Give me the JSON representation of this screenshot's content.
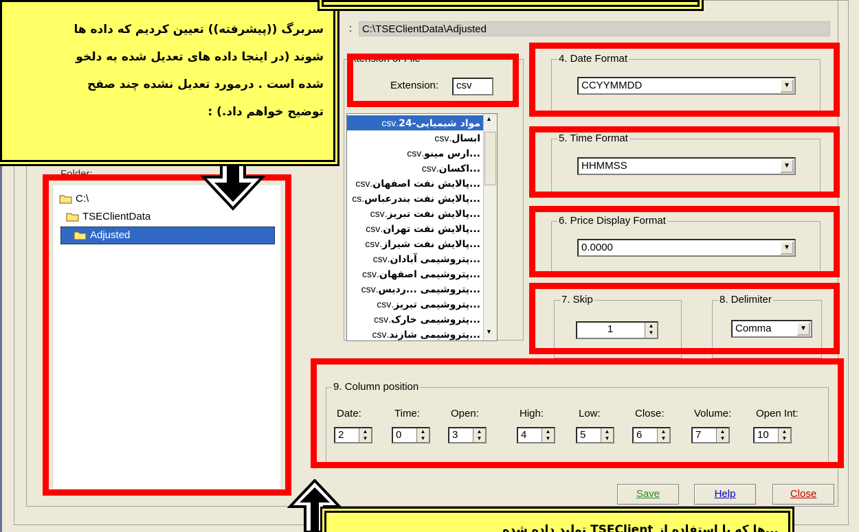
{
  "path": {
    "label": ":",
    "value": "C:\\TSEClientData\\Adjusted"
  },
  "extension_group": {
    "legend": "xtension of File",
    "label": "Extension:",
    "value": "csv"
  },
  "folder": {
    "label": "Folder:",
    "tree": [
      "C:\\",
      "TSEClientData",
      "Adjusted"
    ]
  },
  "files": [
    {
      "name": "مواد شیمیایی-24",
      "ext": ".csv"
    },
    {
      "name": "ابسال",
      "ext": ".csv"
    },
    {
      "name": "...ارس مینو",
      "ext": ".csv"
    },
    {
      "name": "...اکسان",
      "ext": ".csv"
    },
    {
      "name": "...پالایش نفت اصفهان",
      "ext": ".csv"
    },
    {
      "name": "...پالایش نفت بندرعباس",
      "ext": ".cs"
    },
    {
      "name": "...پالایش نفت تبریز",
      "ext": ".csv"
    },
    {
      "name": "...پالایش نفت تهران",
      "ext": ".csv"
    },
    {
      "name": "...پالایش نفت شیراز",
      "ext": ".csv"
    },
    {
      "name": "...پتروشیمی آبادان",
      "ext": ".csv"
    },
    {
      "name": "...پتروشیمی اصفهان",
      "ext": ".csv"
    },
    {
      "name": "...پتروشیمی ...ردیس",
      "ext": ".csv"
    },
    {
      "name": "...پتروشیمی تبریز",
      "ext": ".csv"
    },
    {
      "name": "...پتروشیمی خارک",
      "ext": ".csv"
    },
    {
      "name": "...پتروشیمی شازند",
      "ext": ".csv"
    }
  ],
  "date_format": {
    "legend": "4. Date Format",
    "value": "CCYYMMDD"
  },
  "time_format": {
    "legend": "5. Time Format",
    "value": "HHMMSS"
  },
  "price_format": {
    "legend": "6. Price Display Format",
    "value": "0.0000"
  },
  "skip": {
    "legend": "7. Skip",
    "value": "1"
  },
  "delimiter": {
    "legend": "8. Delimiter",
    "value": "Comma"
  },
  "columns": {
    "legend": "9. Column position",
    "items": [
      {
        "label": "Date:",
        "value": "2"
      },
      {
        "label": "Time:",
        "value": "0"
      },
      {
        "label": "Open:",
        "value": "3"
      },
      {
        "label": "High:",
        "value": "4"
      },
      {
        "label": "Low:",
        "value": "5"
      },
      {
        "label": "Close:",
        "value": "6"
      },
      {
        "label": "Volume:",
        "value": "7"
      },
      {
        "label": "Open Int:",
        "value": "10"
      }
    ]
  },
  "buttons": {
    "save": "Save",
    "help": "Help",
    "close": "Close"
  },
  "note_top": {
    "lines": [
      "سربرگ ((پیشرفته)) تعیین کردیم که داده ها",
      "شوند (در اینجا داده های تعدیل شده به دلخو",
      "شده است    .   درمورد تعدیل نشده چند صفح",
      "توضیح خواهم داد.) :"
    ]
  },
  "note_bottom": {
    "text": "...ها که با استفاده از TSEClient تولید داده شده"
  },
  "colors": {
    "highlight": "#ff0000",
    "note_bg": "#ffff66",
    "selection": "#316ac5"
  }
}
